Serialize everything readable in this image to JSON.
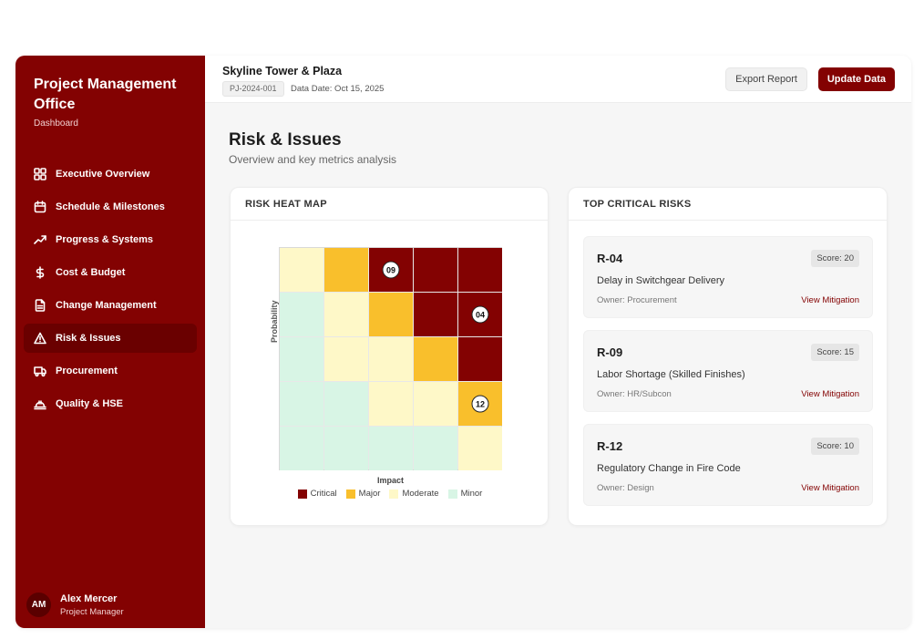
{
  "sidebar": {
    "brand_title": "Project Management Office",
    "brand_sub": "Dashboard",
    "items": [
      {
        "label": "Executive Overview",
        "icon": "grid-icon",
        "active": false
      },
      {
        "label": "Schedule & Milestones",
        "icon": "calendar-icon",
        "active": false
      },
      {
        "label": "Progress & Systems",
        "icon": "trending-up-icon",
        "active": false
      },
      {
        "label": "Cost & Budget",
        "icon": "dollar-icon",
        "active": false
      },
      {
        "label": "Change Management",
        "icon": "document-icon",
        "active": false
      },
      {
        "label": "Risk & Issues",
        "icon": "warning-icon",
        "active": true
      },
      {
        "label": "Procurement",
        "icon": "truck-icon",
        "active": false
      },
      {
        "label": "Quality & HSE",
        "icon": "hard-hat-icon",
        "active": false
      }
    ],
    "user": {
      "initials": "AM",
      "name": "Alex Mercer",
      "role": "Project Manager"
    }
  },
  "header": {
    "project_title": "Skyline Tower & Plaza",
    "project_id": "PJ-2024-001",
    "data_date": "Data Date: Oct 15, 2025",
    "export_label": "Export Report",
    "update_label": "Update Data"
  },
  "page": {
    "title": "Risk & Issues",
    "subtitle": "Overview and key metrics analysis"
  },
  "heatmap": {
    "card_title": "RISK HEAT MAP",
    "x_label": "Impact",
    "y_label": "Probability",
    "colors": {
      "critical": "#830202",
      "major": "#f9bf2c",
      "moderate": "#fef8c8",
      "minor": "#d8f5e5"
    },
    "legend": [
      {
        "key": "critical",
        "label": "Critical"
      },
      {
        "key": "major",
        "label": "Major"
      },
      {
        "key": "moderate",
        "label": "Moderate"
      },
      {
        "key": "minor",
        "label": "Minor"
      }
    ],
    "grid": [
      [
        "moderate",
        "major",
        "critical",
        "critical",
        "critical"
      ],
      [
        "minor",
        "moderate",
        "major",
        "critical",
        "critical"
      ],
      [
        "minor",
        "moderate",
        "moderate",
        "major",
        "critical"
      ],
      [
        "minor",
        "minor",
        "moderate",
        "moderate",
        "major"
      ],
      [
        "minor",
        "minor",
        "minor",
        "minor",
        "moderate"
      ]
    ],
    "markers": [
      {
        "label": "09",
        "row": 0,
        "col": 2
      },
      {
        "label": "04",
        "row": 1,
        "col": 4
      },
      {
        "label": "12",
        "row": 3,
        "col": 4
      }
    ]
  },
  "risks": {
    "card_title": "TOP CRITICAL RISKS",
    "link_label": "View Mitigation",
    "items": [
      {
        "id": "R-04",
        "score": "Score: 20",
        "title": "Delay in Switchgear Delivery",
        "owner": "Owner: Procurement"
      },
      {
        "id": "R-09",
        "score": "Score: 15",
        "title": "Labor Shortage (Skilled Finishes)",
        "owner": "Owner: HR/Subcon"
      },
      {
        "id": "R-12",
        "score": "Score: 10",
        "title": "Regulatory Change in Fire Code",
        "owner": "Owner: Design"
      }
    ]
  }
}
